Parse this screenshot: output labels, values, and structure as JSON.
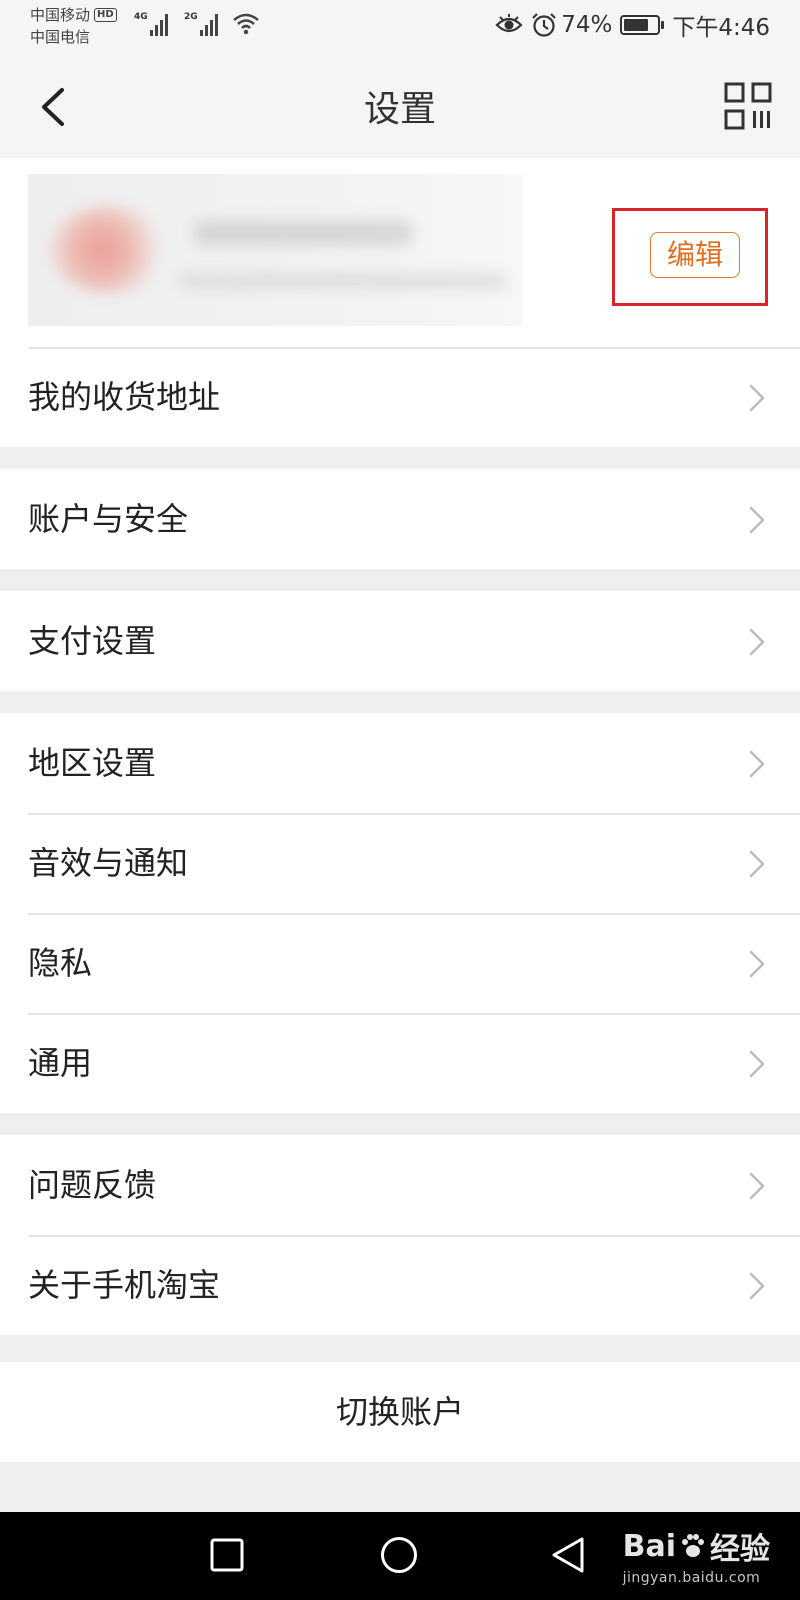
{
  "status_bar": {
    "carrier1": "中国移动",
    "hd_badge": "HD",
    "carrier2": "中国电信",
    "network1": "4G",
    "network2": "2G",
    "battery_percent": "74%",
    "battery_level": 0.74,
    "time": "下午4:46"
  },
  "nav": {
    "title": "设置",
    "back_icon": "chevron-left-icon",
    "qr_icon": "qr-code-icon"
  },
  "profile": {
    "edit_label": "编辑",
    "highlight_color": "#d8242c",
    "accent_color": "#e0701f"
  },
  "groups": [
    {
      "items": [
        {
          "label": "我的收货地址"
        }
      ]
    },
    {
      "items": [
        {
          "label": "账户与安全"
        }
      ]
    },
    {
      "items": [
        {
          "label": "支付设置"
        }
      ]
    },
    {
      "items": [
        {
          "label": "地区设置"
        },
        {
          "label": "音效与通知"
        },
        {
          "label": "隐私"
        },
        {
          "label": "通用"
        }
      ]
    },
    {
      "items": [
        {
          "label": "问题反馈"
        },
        {
          "label": "关于手机淘宝"
        }
      ]
    }
  ],
  "switch_account_label": "切换账户",
  "watermark": {
    "brand": "Bai",
    "brand_suffix": "经验",
    "url": "jingyan.baidu.com"
  }
}
